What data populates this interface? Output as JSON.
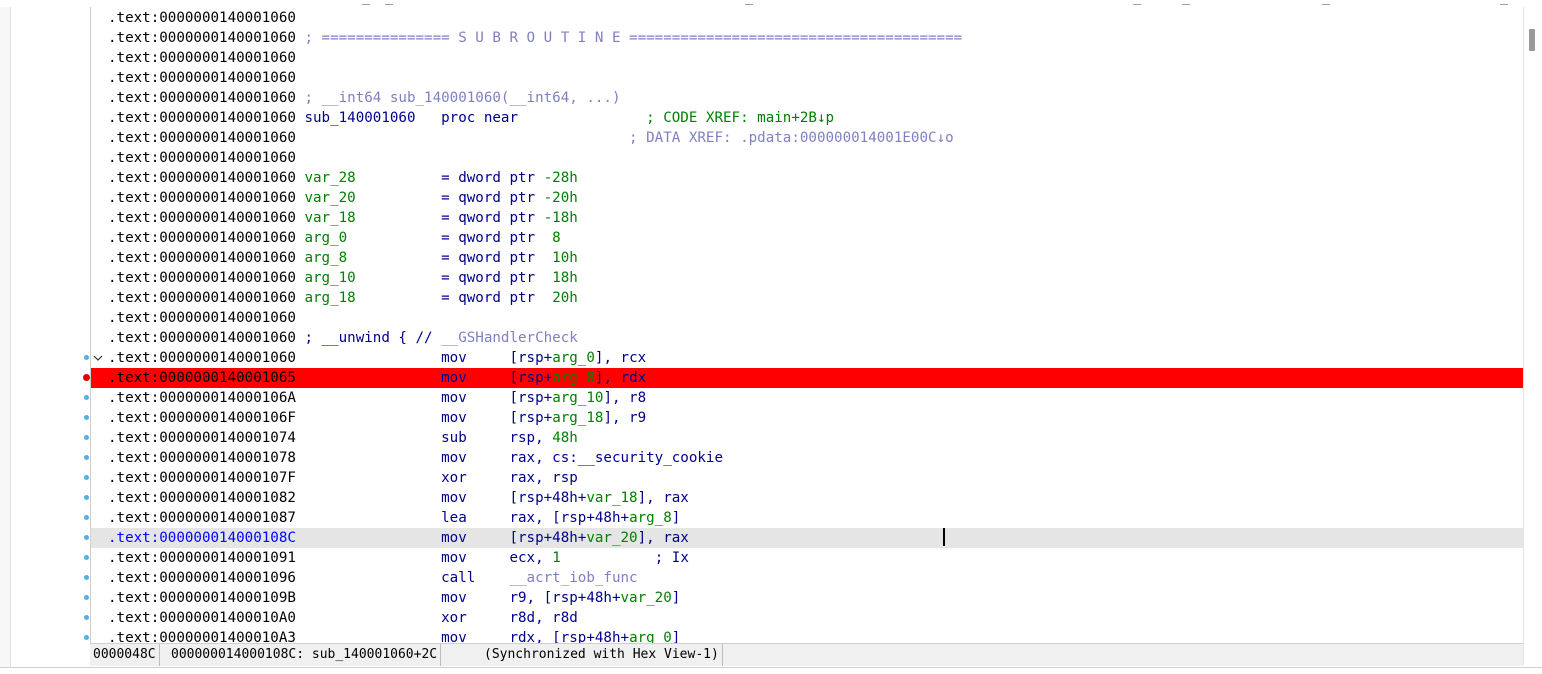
{
  "segment": ".text",
  "rows": [
    {
      "addr": "0000000140001060",
      "parts": []
    },
    {
      "addr": "0000000140001060",
      "parts": [
        {
          "t": " ; =============== S U B R O U T I N E =======================================",
          "c": "cmt"
        }
      ]
    },
    {
      "addr": "0000000140001060",
      "parts": []
    },
    {
      "addr": "0000000140001060",
      "parts": []
    },
    {
      "addr": "0000000140001060",
      "parts": [
        {
          "t": " ; __int64 sub_140001060(__int64, ...)",
          "c": "cmt"
        }
      ]
    },
    {
      "addr": "0000000140001060",
      "parts": [
        {
          "t": " sub_140001060",
          "c": "lbl"
        },
        {
          "t": "   proc near",
          "c": "op"
        },
        {
          "t": "               ; CODE XREF: main+2B↓p",
          "c": "xref"
        }
      ]
    },
    {
      "addr": "0000000140001060",
      "parts": [
        {
          "t": "                                       ; DATA XREF: .pdata:000000014001E00C↓o",
          "c": "xrefd"
        }
      ]
    },
    {
      "addr": "0000000140001060",
      "parts": []
    },
    {
      "addr": "0000000140001060",
      "parts": [
        {
          "t": " var_28",
          "c": "var"
        },
        {
          "t": "          = dword ptr ",
          "c": "op"
        },
        {
          "t": "-28h",
          "c": "num"
        }
      ]
    },
    {
      "addr": "0000000140001060",
      "parts": [
        {
          "t": " var_20",
          "c": "var"
        },
        {
          "t": "          = qword ptr ",
          "c": "op"
        },
        {
          "t": "-20h",
          "c": "num"
        }
      ]
    },
    {
      "addr": "0000000140001060",
      "parts": [
        {
          "t": " var_18",
          "c": "var"
        },
        {
          "t": "          = qword ptr ",
          "c": "op"
        },
        {
          "t": "-18h",
          "c": "num"
        }
      ]
    },
    {
      "addr": "0000000140001060",
      "parts": [
        {
          "t": " arg_0",
          "c": "var"
        },
        {
          "t": "           = qword ptr  ",
          "c": "op"
        },
        {
          "t": "8",
          "c": "num"
        }
      ]
    },
    {
      "addr": "0000000140001060",
      "parts": [
        {
          "t": " arg_8",
          "c": "var"
        },
        {
          "t": "           = qword ptr  ",
          "c": "op"
        },
        {
          "t": "10h",
          "c": "num"
        }
      ]
    },
    {
      "addr": "0000000140001060",
      "parts": [
        {
          "t": " arg_10",
          "c": "var"
        },
        {
          "t": "          = qword ptr  ",
          "c": "op"
        },
        {
          "t": "18h",
          "c": "num"
        }
      ]
    },
    {
      "addr": "0000000140001060",
      "parts": [
        {
          "t": " arg_18",
          "c": "var"
        },
        {
          "t": "          = qword ptr  ",
          "c": "op"
        },
        {
          "t": "20h",
          "c": "num"
        }
      ]
    },
    {
      "addr": "0000000140001060",
      "parts": []
    },
    {
      "addr": "0000000140001060",
      "parts": [
        {
          "t": " ; __unwind { // ",
          "c": "op"
        },
        {
          "t": "__GSHandlerCheck",
          "c": "fn"
        }
      ]
    },
    {
      "addr": "0000000140001060",
      "dot": true,
      "fold": true,
      "parts": [
        {
          "t": "                 mov     ",
          "c": "op"
        },
        {
          "t": "[rsp+",
          "c": "op"
        },
        {
          "t": "arg_0",
          "c": "var"
        },
        {
          "t": "], rcx",
          "c": "op"
        }
      ]
    },
    {
      "addr": "0000000140001065",
      "bp": true,
      "hl": true,
      "parts": [
        {
          "t": "                 mov     ",
          "c": "op"
        },
        {
          "t": "[rsp+",
          "c": "op"
        },
        {
          "t": "arg_8",
          "c": "var"
        },
        {
          "t": "], rdx",
          "c": "op"
        }
      ]
    },
    {
      "addr": "000000014000106A",
      "dot": true,
      "parts": [
        {
          "t": "                 mov     ",
          "c": "op"
        },
        {
          "t": "[rsp+",
          "c": "op"
        },
        {
          "t": "arg_10",
          "c": "var"
        },
        {
          "t": "], r8",
          "c": "op"
        }
      ]
    },
    {
      "addr": "000000014000106F",
      "dot": true,
      "parts": [
        {
          "t": "                 mov     ",
          "c": "op"
        },
        {
          "t": "[rsp+",
          "c": "op"
        },
        {
          "t": "arg_18",
          "c": "var"
        },
        {
          "t": "], r9",
          "c": "op"
        }
      ]
    },
    {
      "addr": "0000000140001074",
      "dot": true,
      "parts": [
        {
          "t": "                 sub     ",
          "c": "op"
        },
        {
          "t": "rsp, ",
          "c": "op"
        },
        {
          "t": "48h",
          "c": "num"
        }
      ]
    },
    {
      "addr": "0000000140001078",
      "dot": true,
      "parts": [
        {
          "t": "                 mov     ",
          "c": "op"
        },
        {
          "t": "rax, cs:",
          "c": "op"
        },
        {
          "t": "__security_cookie",
          "c": "op"
        }
      ]
    },
    {
      "addr": "000000014000107F",
      "dot": true,
      "parts": [
        {
          "t": "                 xor     ",
          "c": "op"
        },
        {
          "t": "rax, rsp",
          "c": "op"
        }
      ]
    },
    {
      "addr": "0000000140001082",
      "dot": true,
      "parts": [
        {
          "t": "                 mov     ",
          "c": "op"
        },
        {
          "t": "[rsp+48h+",
          "c": "op"
        },
        {
          "t": "var_18",
          "c": "var"
        },
        {
          "t": "], rax",
          "c": "op"
        }
      ]
    },
    {
      "addr": "0000000140001087",
      "dot": true,
      "parts": [
        {
          "t": "                 lea     ",
          "c": "op"
        },
        {
          "t": "rax, [rsp+48h+",
          "c": "op"
        },
        {
          "t": "arg_8",
          "c": "var"
        },
        {
          "t": "]",
          "c": "op"
        }
      ]
    },
    {
      "addr": "000000014000108C",
      "dot": true,
      "cur": true,
      "parts": [
        {
          "t": "                 mov     ",
          "c": "op"
        },
        {
          "t": "[rsp+48h+",
          "c": "op"
        },
        {
          "t": "var_20",
          "c": "var"
        },
        {
          "t": "], rax",
          "c": "op"
        }
      ]
    },
    {
      "addr": "0000000140001091",
      "dot": true,
      "parts": [
        {
          "t": "                 mov     ",
          "c": "op"
        },
        {
          "t": "ecx, ",
          "c": "op"
        },
        {
          "t": "1",
          "c": "num"
        },
        {
          "t": "           ; Ix",
          "c": "op"
        }
      ]
    },
    {
      "addr": "0000000140001096",
      "dot": true,
      "parts": [
        {
          "t": "                 call    ",
          "c": "op"
        },
        {
          "t": "__acrt_iob_func",
          "c": "fn"
        }
      ]
    },
    {
      "addr": "000000014000109B",
      "dot": true,
      "parts": [
        {
          "t": "                 mov     ",
          "c": "op"
        },
        {
          "t": "r9, [rsp+48h+",
          "c": "op"
        },
        {
          "t": "var_20",
          "c": "var"
        },
        {
          "t": "]",
          "c": "op"
        }
      ]
    },
    {
      "addr": "00000001400010A0",
      "dot": true,
      "parts": [
        {
          "t": "                 xor     ",
          "c": "op"
        },
        {
          "t": "r8d, r8d",
          "c": "op"
        }
      ]
    },
    {
      "addr": "00000001400010A3",
      "dot": true,
      "parts": [
        {
          "t": "                 mov     ",
          "c": "op"
        },
        {
          "t": "rdx, [rsp+48h+",
          "c": "op"
        },
        {
          "t": "arg_0",
          "c": "var"
        },
        {
          "t": "]",
          "c": "op"
        }
      ]
    }
  ],
  "status": {
    "offset": "0000048C",
    "location": "000000014000108C: sub_140001060+2C",
    "sync": "(Synchronized with Hex View-1)"
  }
}
